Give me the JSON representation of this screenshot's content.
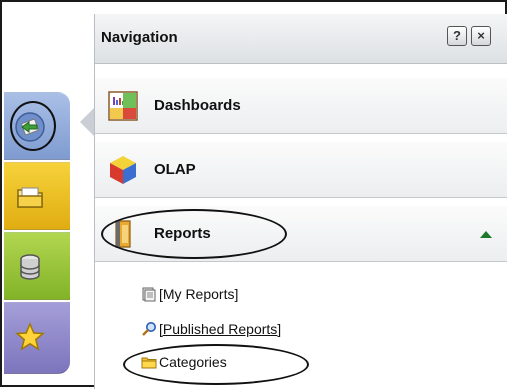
{
  "panel": {
    "title": "Navigation",
    "help_label": "?",
    "close_label": "×"
  },
  "sections": [
    {
      "label": "Dashboards",
      "icon": "dashboard-chart-icon"
    },
    {
      "label": "OLAP",
      "icon": "olap-cube-icon"
    },
    {
      "label": "Reports",
      "icon": "reports-book-icon",
      "expanded": true
    }
  ],
  "report_items": [
    {
      "label": "[My Reports]",
      "icon": "my-reports-icon"
    },
    {
      "label": "[Published Reports]",
      "icon": "search-icon"
    },
    {
      "label": "Categories",
      "icon": "folder-icon"
    }
  ],
  "dock": [
    {
      "icon": "navigation-arrow-icon",
      "color": "#8fa8d8",
      "selected": true
    },
    {
      "icon": "folder-icon",
      "color": "#f0c52a"
    },
    {
      "icon": "database-icon",
      "color": "#9cc63a"
    },
    {
      "icon": "star-icon",
      "color": "#938bcc"
    }
  ],
  "colors": {
    "accent_arrow": "#1a7a2a",
    "annotation_ring": "#111111"
  }
}
